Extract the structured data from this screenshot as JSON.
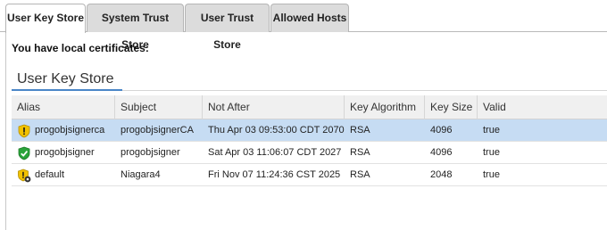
{
  "tabs": [
    {
      "label": "User Key Store",
      "active": true
    },
    {
      "label": "System Trust Store",
      "active": false
    },
    {
      "label": "User Trust Store",
      "active": false
    },
    {
      "label": "Allowed Hosts",
      "active": false
    }
  ],
  "intro_text": "You have local certificates:",
  "section_title": "User Key Store",
  "table": {
    "columns": [
      "Alias",
      "Subject",
      "Not After",
      "Key Algorithm",
      "Key Size",
      "Valid"
    ],
    "rows": [
      {
        "icon": "shield-warning-icon",
        "alias": "progobjsignerca",
        "subject": "progobjsignerCA",
        "not_after": "Thu Apr 03 09:53:00 CDT 2070",
        "key_algorithm": "RSA",
        "key_size": "4096",
        "valid": "true",
        "selected": true
      },
      {
        "icon": "shield-check-icon",
        "alias": "progobjsigner",
        "subject": "progobjsigner",
        "not_after": "Sat Apr 03 11:06:07 CDT 2027",
        "key_algorithm": "RSA",
        "key_size": "4096",
        "valid": "true",
        "selected": false
      },
      {
        "icon": "shield-warning-gear-icon",
        "alias": "default",
        "subject": "Niagara4",
        "not_after": "Fri Nov 07 11:24:36 CST 2025",
        "key_algorithm": "RSA",
        "key_size": "2048",
        "valid": "true",
        "selected": false
      }
    ]
  },
  "colors": {
    "selected_row": "#c6dcf3",
    "tab_underline": "#4a86c7",
    "warning": "#f2c200",
    "ok": "#2aa33a"
  }
}
